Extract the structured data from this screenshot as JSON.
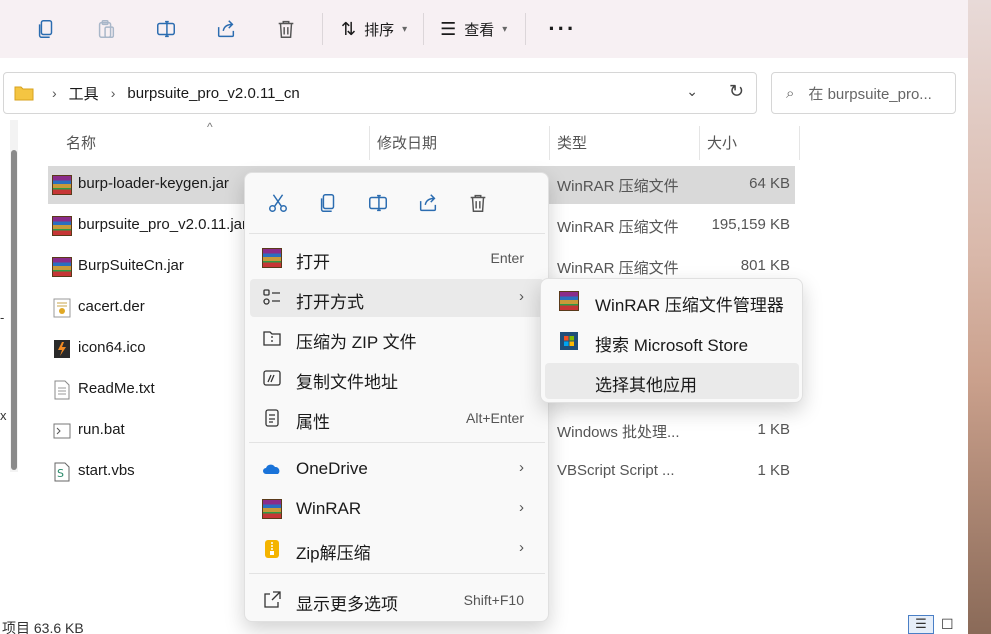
{
  "toolbar": {
    "sort_label": "排序",
    "view_label": "查看",
    "more_label": "···"
  },
  "address": {
    "crumbs": [
      "工具",
      "burpsuite_pro_v2.0.11_cn"
    ],
    "search_placeholder": "在 burpsuite_pro..."
  },
  "columns": {
    "name": "名称",
    "modified": "修改日期",
    "type": "类型",
    "size": "大小"
  },
  "files": [
    {
      "name": "burp-loader-keygen.jar",
      "type": "WinRAR 压缩文件",
      "size": "64 KB",
      "icon": "winrar-icon",
      "selected": true
    },
    {
      "name": "burpsuite_pro_v2.0.11.jar",
      "type": "WinRAR 压缩文件",
      "size": "195,159 KB",
      "icon": "winrar-icon"
    },
    {
      "name": "BurpSuiteCn.jar",
      "type": "WinRAR 压缩文件",
      "size": "801 KB",
      "icon": "winrar-icon"
    },
    {
      "name": "cacert.der",
      "type": "",
      "size": "",
      "icon": "certificate-icon"
    },
    {
      "name": "icon64.ico",
      "type": "",
      "size": "",
      "icon": "image-icon"
    },
    {
      "name": "ReadMe.txt",
      "type": "",
      "size": "",
      "icon": "text-file-icon"
    },
    {
      "name": "run.bat",
      "type": "Windows 批处理...",
      "size": "1 KB",
      "icon": "batch-file-icon"
    },
    {
      "name": "start.vbs",
      "type": "VBScript Script ...",
      "size": "1 KB",
      "icon": "script-file-icon"
    }
  ],
  "status": {
    "text": "项目  63.6 KB"
  },
  "context_menu": {
    "items": [
      {
        "label": "打开",
        "shortcut": "Enter",
        "icon": "winrar-icon"
      },
      {
        "label": "打开方式",
        "icon": "open-with-icon",
        "has_submenu": true
      },
      {
        "label": "压缩为 ZIP 文件",
        "icon": "zip-folder-icon"
      },
      {
        "label": "复制文件地址",
        "icon": "copy-path-icon"
      },
      {
        "label": "属性",
        "shortcut": "Alt+Enter",
        "icon": "properties-icon"
      },
      {
        "label": "OneDrive",
        "icon": "onedrive-icon",
        "has_submenu": true
      },
      {
        "label": "WinRAR",
        "icon": "winrar-icon",
        "has_submenu": true
      },
      {
        "label": "Zip解压缩",
        "icon": "zip-extract-icon",
        "has_submenu": true
      },
      {
        "label": "显示更多选项",
        "shortcut": "Shift+F10",
        "icon": "more-options-icon"
      }
    ]
  },
  "submenu": {
    "items": [
      {
        "label": "WinRAR 压缩文件管理器",
        "icon": "winrar-icon"
      },
      {
        "label": "搜索 Microsoft Store",
        "icon": "store-icon"
      },
      {
        "label": "选择其他应用",
        "icon": ""
      }
    ]
  }
}
